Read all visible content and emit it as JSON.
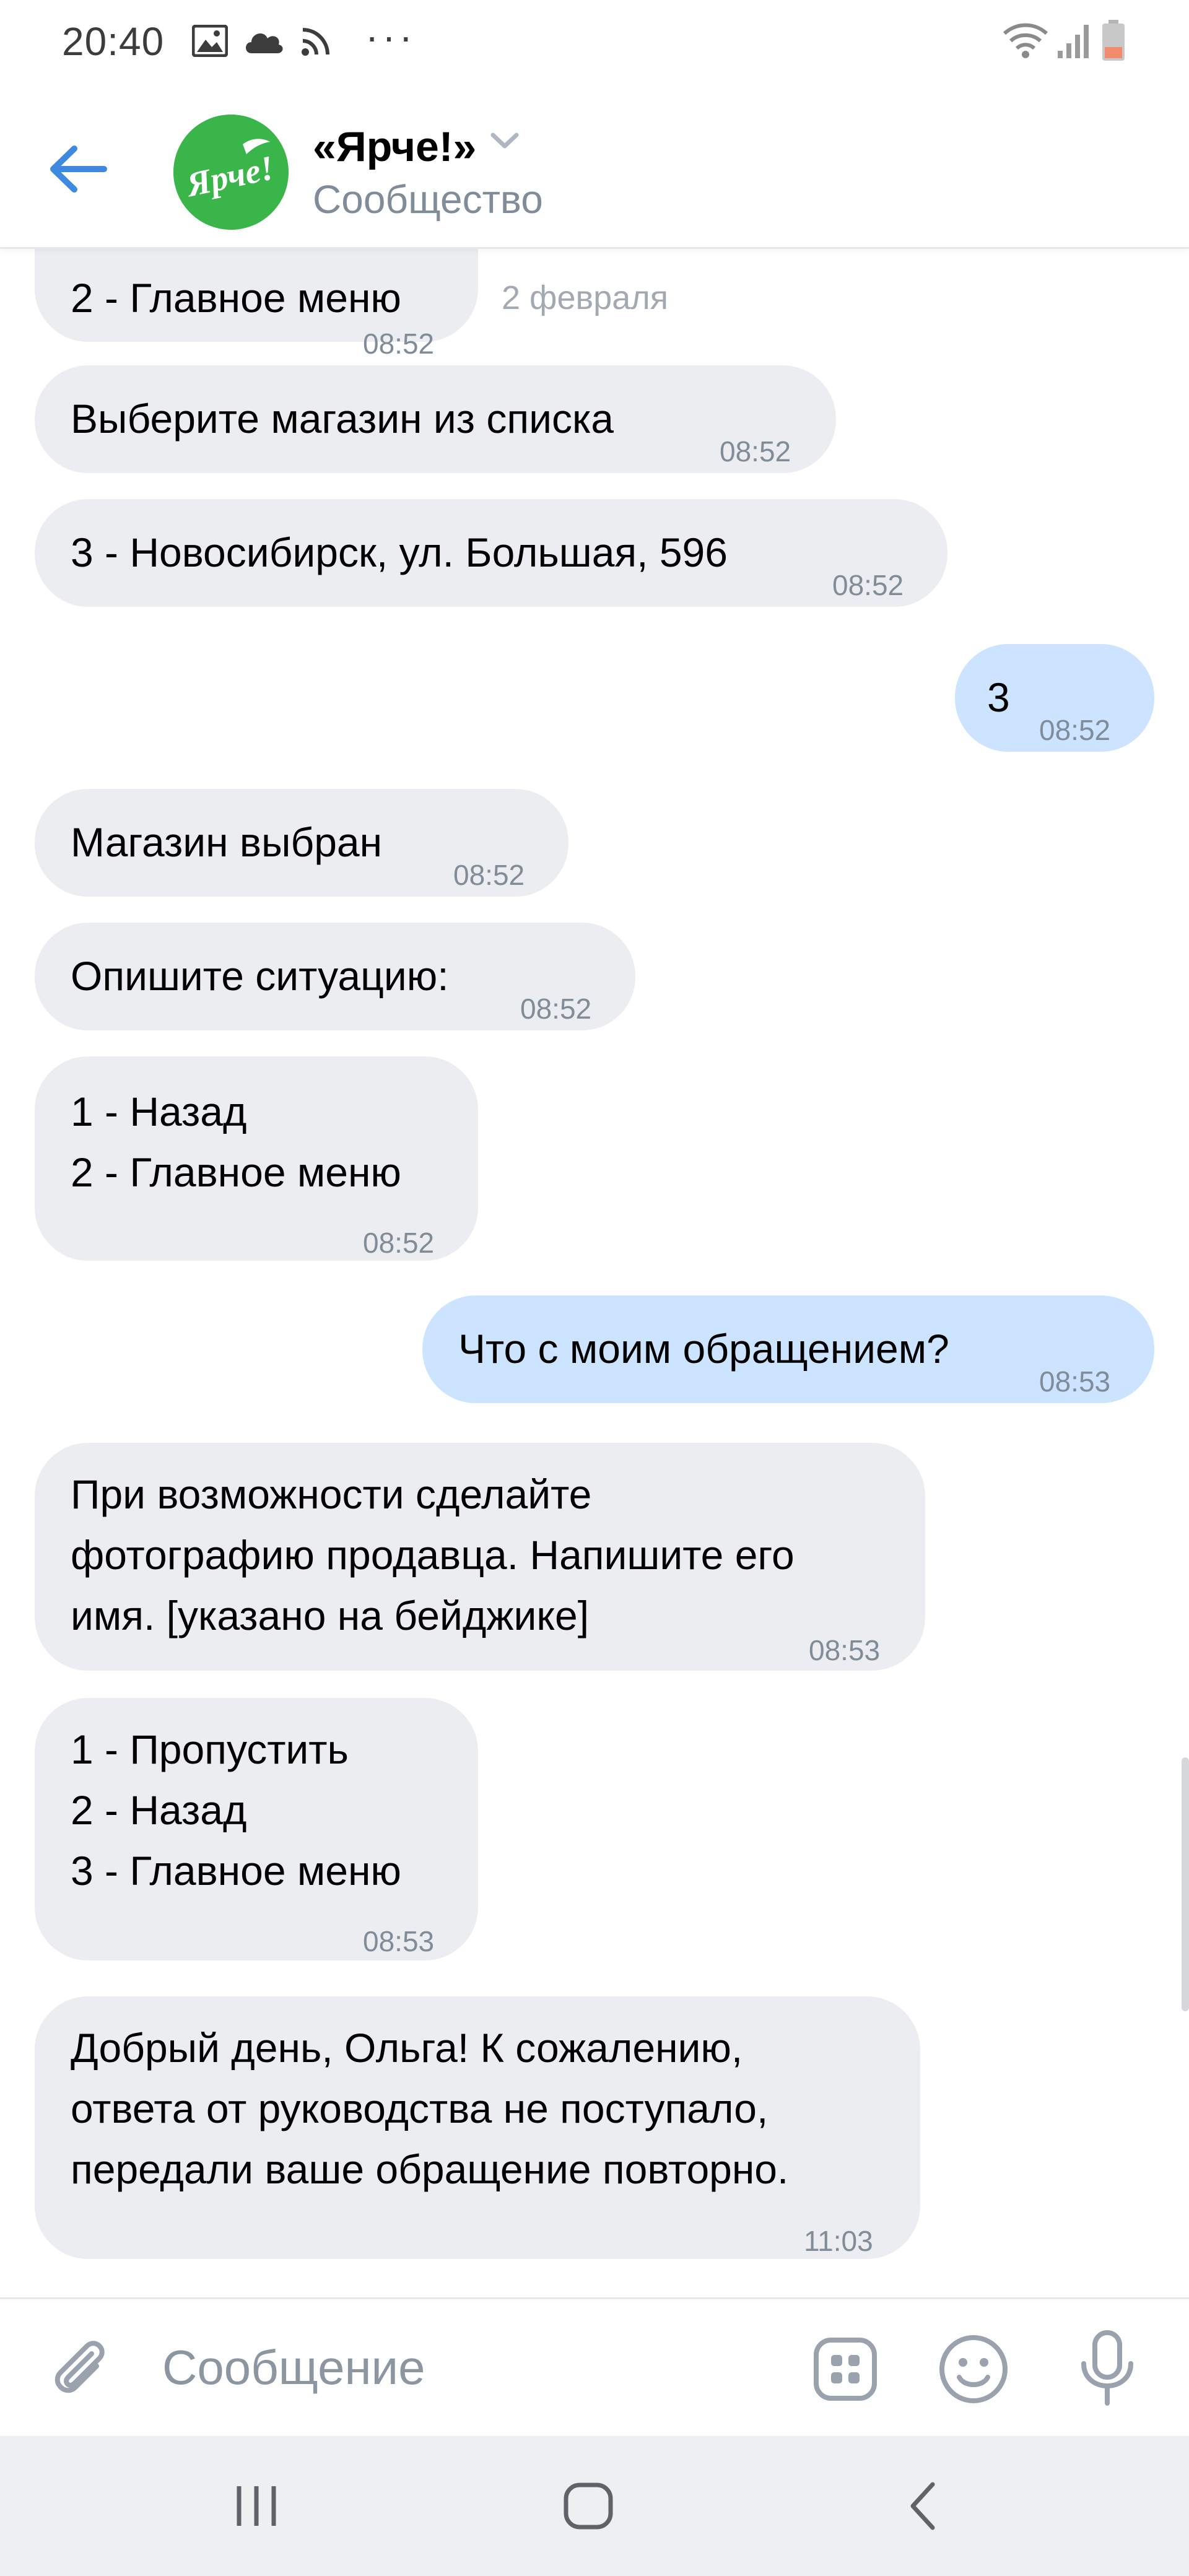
{
  "status_bar": {
    "time": "20:40",
    "dots": "···",
    "icons": [
      "gallery-icon",
      "cloud-icon",
      "cast-icon",
      "wifi-icon",
      "signal-icon",
      "battery-icon"
    ]
  },
  "header": {
    "title": "«Ярче!»",
    "subtitle": "Сообщество",
    "avatar_text": "Ярче!",
    "avatar_color": "#39b54a"
  },
  "chat": {
    "date_separator": "2 февраля",
    "messages": [
      {
        "dir": "in",
        "text": "2 - Главное меню",
        "time": "08:52"
      },
      {
        "dir": "in",
        "text": "Выберите магазин из списка",
        "time": "08:52"
      },
      {
        "dir": "in",
        "text": "3 - Новосибирск, ул. Большая, 596",
        "time": "08:52"
      },
      {
        "dir": "out",
        "text": "3",
        "time": "08:52"
      },
      {
        "dir": "in",
        "text": "Магазин выбран",
        "time": "08:52"
      },
      {
        "dir": "in",
        "text": "Опишите ситуацию:",
        "time": "08:52"
      },
      {
        "dir": "in",
        "lines": [
          "1 - Назад",
          "2 - Главное меню"
        ],
        "time": "08:52"
      },
      {
        "dir": "out",
        "text": "Что с моим обращением?",
        "time": "08:53"
      },
      {
        "dir": "in",
        "lines": [
          "При возможности сделайте",
          "фотографию продавца. Напишите его",
          "имя. [указано на бейджике]"
        ],
        "time": "08:53"
      },
      {
        "dir": "in",
        "lines": [
          "1 - Пропустить",
          "2 - Назад",
          "3 - Главное меню"
        ],
        "time": "08:53"
      },
      {
        "dir": "in",
        "lines": [
          "Добрый день, Ольга! К сожалению,",
          "ответа от руководства не поступало,",
          "передали ваше обращение повторно."
        ],
        "time": "11:03"
      }
    ]
  },
  "composer": {
    "placeholder": "Сообщение"
  },
  "colors": {
    "incoming_bubble": "#ebedf0",
    "outgoing_bubble": "#cce4ff",
    "accent": "#3f8ae0",
    "secondary_text": "#818c99"
  }
}
